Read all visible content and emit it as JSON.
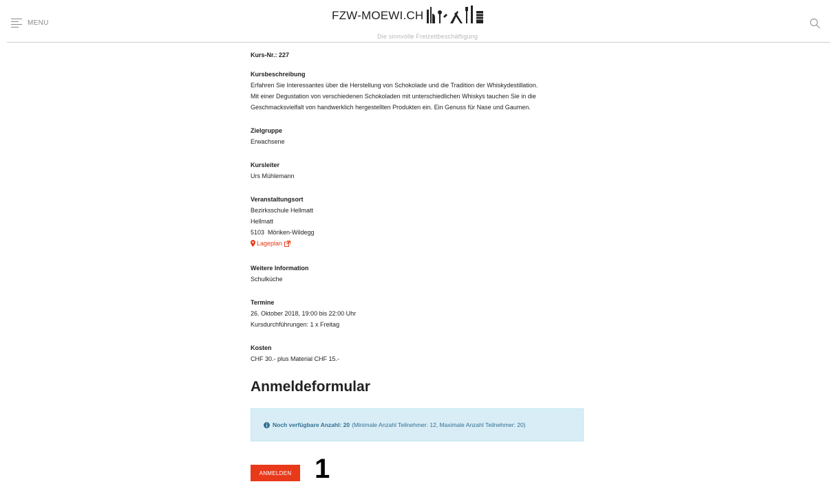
{
  "header": {
    "menu_label": "MENU",
    "logo_text": "FZW-MOEWI.CH",
    "tagline": "Die sinnvolle Freizeitbeschäftigung"
  },
  "course": {
    "kursnr": "Kurs-Nr.: 227",
    "beschreibung_label": "Kursbeschreibung",
    "beschreibung_lines": [
      "Erfahren Sie Interessantes über die Herstellung von Schokolade und die Tradition der Whiskydestillation.",
      "Mit einer Degustation von verschiedenen Schokoladen mit unterschiedlichen Whiskys tauchen Sie in die",
      "Geschmacksvielfalt von handwerklich hergestellten Produkten ein. Ein Genuss für Nase und Gaumen."
    ],
    "zielgruppe_label": "Zielgruppe",
    "zielgruppe": "Erwachsene",
    "kursleiter_label": "Kursleiter",
    "kursleiter": "Urs Mühlemann",
    "ort_label": "Veranstaltungsort",
    "ort_lines": [
      "Bezirksschule Hellmatt",
      "Hellmatt",
      "5103  Möriken-Wildegg"
    ],
    "lageplan": "Lageplan",
    "weitere_label": "Weitere Information",
    "weitere": "Schulküche",
    "termine_label": "Termine",
    "termine_lines": [
      "26. Oktober 2018, 19:00 bis 22:00 Uhr",
      "Kursdurchführungen: 1 x Freitag"
    ],
    "kosten_label": "Kosten",
    "kosten": "CHF 30.- plus Material CHF 15.-"
  },
  "form": {
    "title": "Anmeldeformular",
    "info_strong": "Noch verfügbare Anzahl: 20",
    "info_rest": "(Minimale Anzahl Teilnehmer: 12, Maximale Anzahl Teilnehmer: 20)",
    "button_label": "ANMELDEN",
    "annotation": "1"
  },
  "colors": {
    "accent": "#e8391a",
    "info_bg": "#d9edf7",
    "info_text": "#31708f"
  },
  "icons": [
    "menu-icon",
    "logo-tools-icon",
    "search-icon",
    "map-marker-icon",
    "external-link-icon",
    "info-circle-icon"
  ]
}
